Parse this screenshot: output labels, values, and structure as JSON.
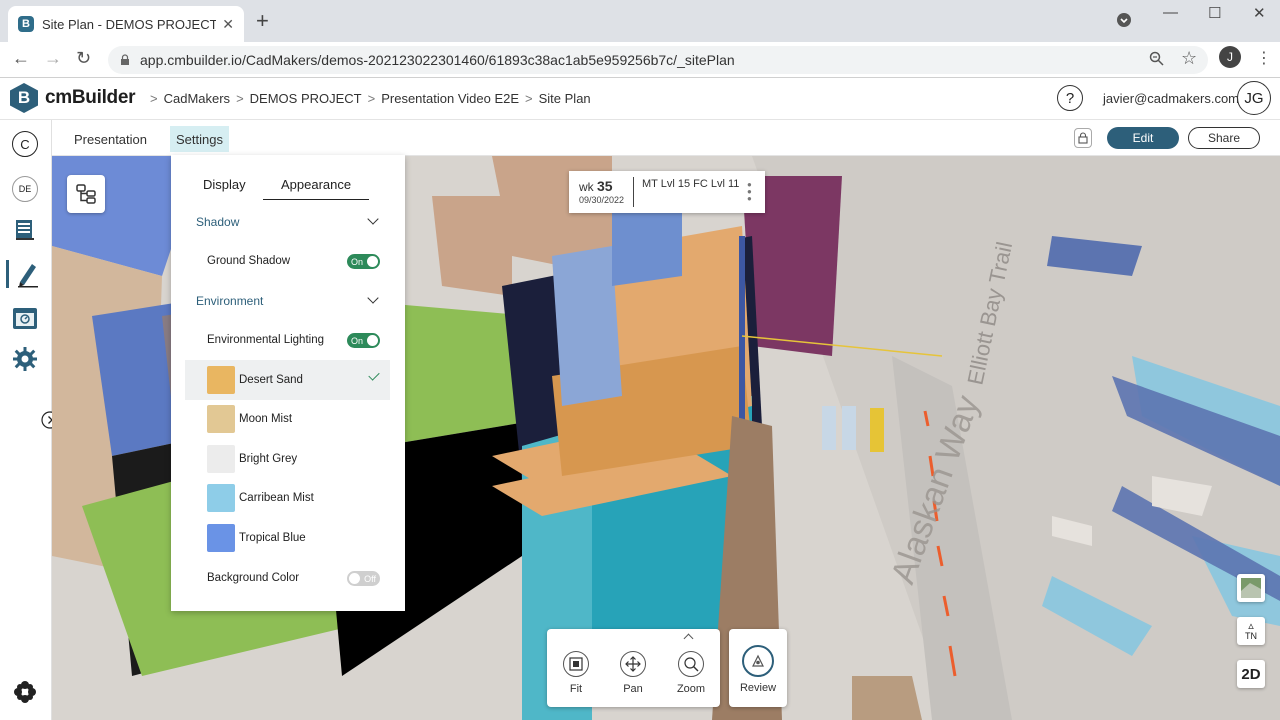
{
  "browser": {
    "tab_title": "Site Plan - DEMOS PROJECT | cm",
    "favicon": "B",
    "url": "app.cmbuilder.io/CadMakers/demos-202123022301460/61893c38ac1ab5e959256b7c/_sitePlan",
    "profile_initial": "J"
  },
  "app": {
    "logo_badge": "B",
    "logo_text": "cmBuilder",
    "breadcrumbs": [
      "CadMakers",
      "DEMOS PROJECT",
      "Presentation Video E2E",
      "Site Plan"
    ],
    "help": "?",
    "user_email": "javier@cadmakers.com",
    "user_initials": "JG"
  },
  "rail": {
    "c_label": "C",
    "de_label": "DE"
  },
  "toolbar": {
    "tab_presentation": "Presentation",
    "tab_settings": "Settings",
    "edit_label": "Edit",
    "share_label": "Share"
  },
  "week_card": {
    "wk_prefix": "wk",
    "wk_number": "35",
    "date": "09/30/2022",
    "activity": "MT Lvl 15 FC Lvl 11"
  },
  "settings_panel": {
    "tab_display": "Display",
    "tab_appearance": "Appearance",
    "shadow_header": "Shadow",
    "ground_shadow_label": "Ground Shadow",
    "ground_shadow_state": "On",
    "environment_header": "Environment",
    "env_lighting_label": "Environmental Lighting",
    "env_lighting_state": "On",
    "swatches": [
      {
        "name": "Desert Sand",
        "color": "#e9b661",
        "selected": true
      },
      {
        "name": "Moon Mist",
        "color": "#e2c894",
        "selected": false
      },
      {
        "name": "Bright Grey",
        "color": "#ececec",
        "selected": false
      },
      {
        "name": "Carribean Mist",
        "color": "#8ecde8",
        "selected": false
      },
      {
        "name": "Tropical Blue",
        "color": "#6a93e6",
        "selected": false
      }
    ],
    "background_color_label": "Background Color",
    "background_color_state": "Off"
  },
  "nav_tools": {
    "fit": "Fit",
    "pan": "Pan",
    "zoom": "Zoom",
    "review": "Review"
  },
  "side_tools": {
    "north": "TN",
    "view_mode": "2D"
  },
  "map_labels": {
    "street_1": "Alaskan Way",
    "street_2": "Elliott Bay Trail"
  },
  "colors": {
    "brand": "#2d5f7a",
    "toggle_on": "#2d8a5a",
    "active_tab_bg": "#d6eef2"
  }
}
